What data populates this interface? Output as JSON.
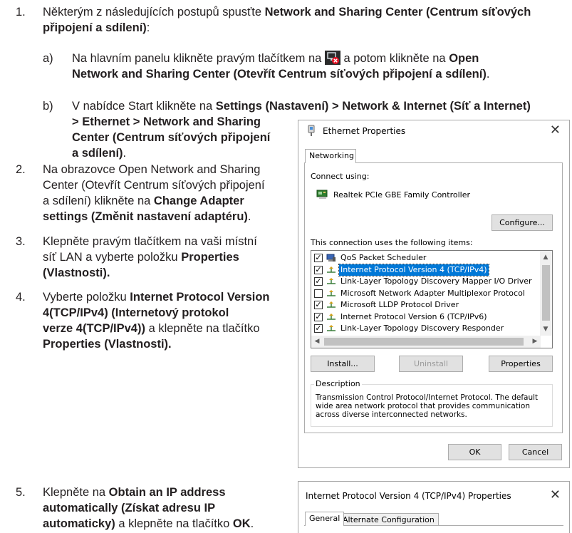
{
  "steps": [
    {
      "number": "1.",
      "text_a": "Některým z následujících postupů spusťte ",
      "bold_a": "Network and Sharing Center (Centrum síťových",
      "bold_b": "připojení a sdílení)",
      "text_b": ":",
      "substeps": [
        {
          "letter": "a)",
          "text_a": "Na hlavním panelu klikněte pravým tlačítkem na ",
          "text_b": " a potom klikněte na ",
          "bold_a": "Open",
          "bold_b": "Network and Sharing Center (Otevřít Centrum síťových připojení a sdílení)",
          "text_c": "."
        },
        {
          "letter": "b)",
          "text_a": "V nabídce Start klikněte na ",
          "bold_a": "Settings (Nastavení) > Network & Internet (Síť a Internet)",
          "bold_b": "> Ethernet > Network and Sharing",
          "bold_c": "Center (Centrum síťových připojení",
          "bold_d": "a sdílení)",
          "text_b": "."
        }
      ]
    },
    {
      "number": "2.",
      "line1": "Na obrazovce Open Network and Sharing",
      "line2": "Center (Otevřít Centrum síťových připojení",
      "line3": "a sdílení) klikněte na ",
      "bold_a": "Change Adapter",
      "bold_b": "settings (Změnit nastavení adaptéru)",
      "text_end": "."
    },
    {
      "number": "3.",
      "line1": "Klepněte pravým tlačítkem na vaši místní",
      "line2": "síť LAN a vyberte položku ",
      "bold_a": "Properties",
      "bold_b": "(Vlastnosti)."
    },
    {
      "number": "4.",
      "line1": "Vyberte položku ",
      "bold_a": "Internet Protocol Version",
      "bold_b": "4(TCP/IPv4) (Internetový protokol",
      "bold_c": "verze 4(TCP/IPv4))",
      "line3": " a klepněte na tlačítko",
      "bold_d": "Properties (Vlastnosti)."
    },
    {
      "number": "5.",
      "line1": "Klepněte na ",
      "bold_a": "Obtain an IP address",
      "bold_b": "automatically (Získat adresu IP",
      "bold_c": "automaticky)",
      "line3": " a klepněte na tlačítko ",
      "bold_d": "OK",
      "text_end": "."
    }
  ],
  "ethernet_dialog": {
    "title": "Ethernet Properties",
    "tab": "Networking",
    "connect_using_label": "Connect using:",
    "adapter": "Realtek PCIe GBE Family Controller",
    "configure_button": "Configure...",
    "items_label": "This connection uses the following items:",
    "items": [
      {
        "label": "QoS Packet Scheduler",
        "checked": true,
        "selected": false
      },
      {
        "label": "Internet Protocol Version 4 (TCP/IPv4)",
        "checked": true,
        "selected": true
      },
      {
        "label": "Link-Layer Topology Discovery Mapper I/O Driver",
        "checked": true,
        "selected": false
      },
      {
        "label": "Microsoft Network Adapter Multiplexor Protocol",
        "checked": false,
        "selected": false
      },
      {
        "label": "Microsoft LLDP Protocol Driver",
        "checked": true,
        "selected": false
      },
      {
        "label": "Internet Protocol Version 6 (TCP/IPv6)",
        "checked": true,
        "selected": false
      },
      {
        "label": "Link-Layer Topology Discovery Responder",
        "checked": true,
        "selected": false
      }
    ],
    "install_button": "Install...",
    "uninstall_button": "Uninstall",
    "properties_button": "Properties",
    "description_label": "Description",
    "description_text_1": "Transmission Control Protocol/Internet Protocol. The default",
    "description_text_2": "wide area network protocol that provides communication",
    "description_text_3": "across diverse interconnected networks.",
    "ok_button": "OK",
    "cancel_button": "Cancel",
    "selection_color": "#0078d7"
  },
  "ipv4_dialog": {
    "title": "Internet Protocol Version 4 (TCP/IPv4) Properties",
    "tab_general": "General",
    "tab_alternate": "Alternate Configuration"
  }
}
